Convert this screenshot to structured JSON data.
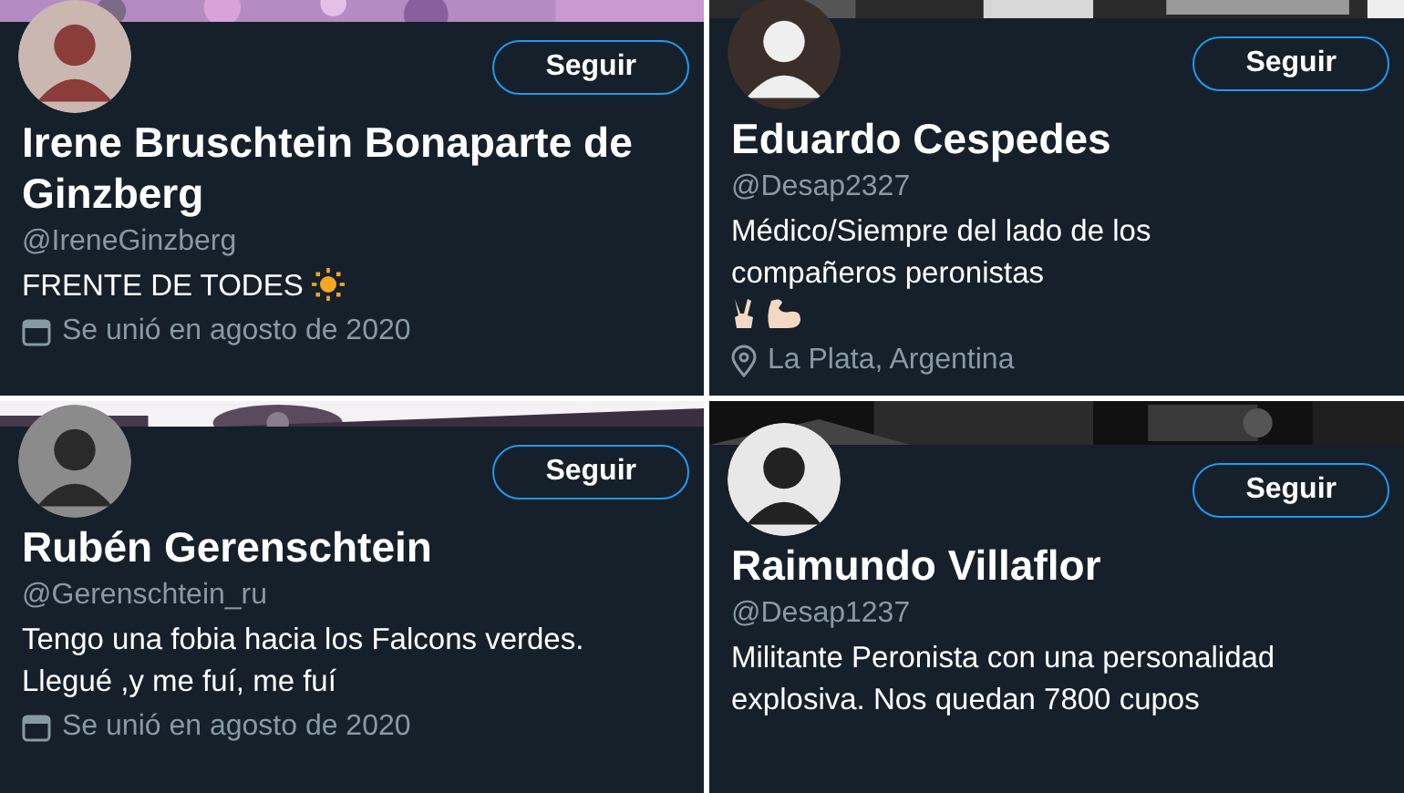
{
  "profiles": [
    {
      "button": "Seguir",
      "name": "Irene Bruschtein Bonaparte de Ginzberg",
      "handle": "@IreneGinzberg",
      "bio": "FRENTE DE TODES",
      "meta": {
        "kind": "joined",
        "text": "Se unió en agosto de 2020"
      }
    },
    {
      "button": "Seguir",
      "name": "Eduardo Cespedes",
      "handle": "@Desap2327",
      "bio": "Médico/Siempre del lado de los compañeros peronistas",
      "meta": {
        "kind": "location",
        "text": "La Plata, Argentina"
      }
    },
    {
      "button": "Seguir",
      "name": "Rubén Gerenschtein",
      "handle": "@Gerenschtein_ru",
      "bio": "Tengo una fobia hacia los Falcons verdes. Llegué ,y me fuí, me fuí",
      "meta": {
        "kind": "joined",
        "text": "Se unió en agosto de 2020"
      }
    },
    {
      "button": "Seguir",
      "name": "Raimundo Villaflor",
      "handle": "@Desap1237",
      "bio": "Militante Peronista con una personalidad explosiva. Nos quedan 7800 cupos"
    }
  ]
}
